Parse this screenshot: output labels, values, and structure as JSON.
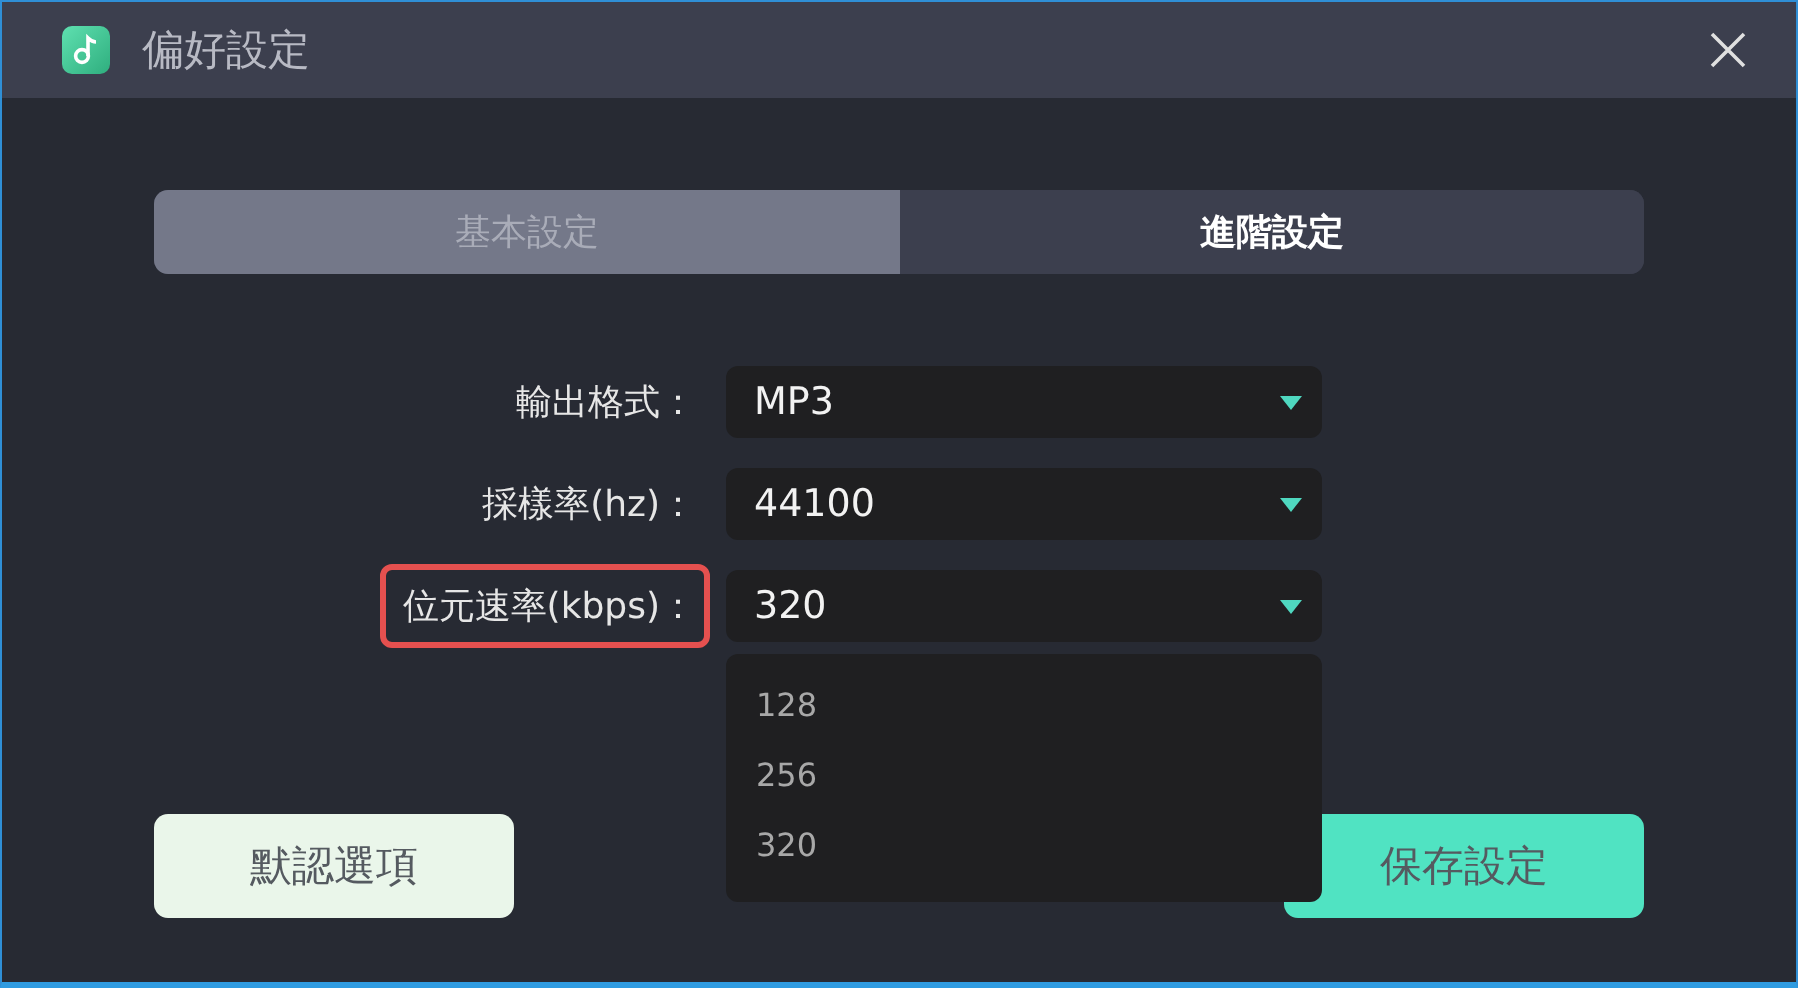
{
  "window": {
    "title": "偏好設定"
  },
  "tabs": [
    {
      "label": "基本設定",
      "selected": false
    },
    {
      "label": "進階設定",
      "selected": true
    }
  ],
  "fields": [
    {
      "label": "輸出格式：",
      "value": "MP3",
      "highlighted": false
    },
    {
      "label": "採樣率(hz)：",
      "value": "44100",
      "highlighted": false
    },
    {
      "label": "位元速率(kbps)：",
      "value": "320",
      "highlighted": true,
      "open_options": [
        "128",
        "256",
        "320"
      ]
    }
  ],
  "buttons": [
    {
      "label": "默認選項",
      "kind": "secondary"
    },
    {
      "label": "保存設定",
      "kind": "primary"
    }
  ]
}
